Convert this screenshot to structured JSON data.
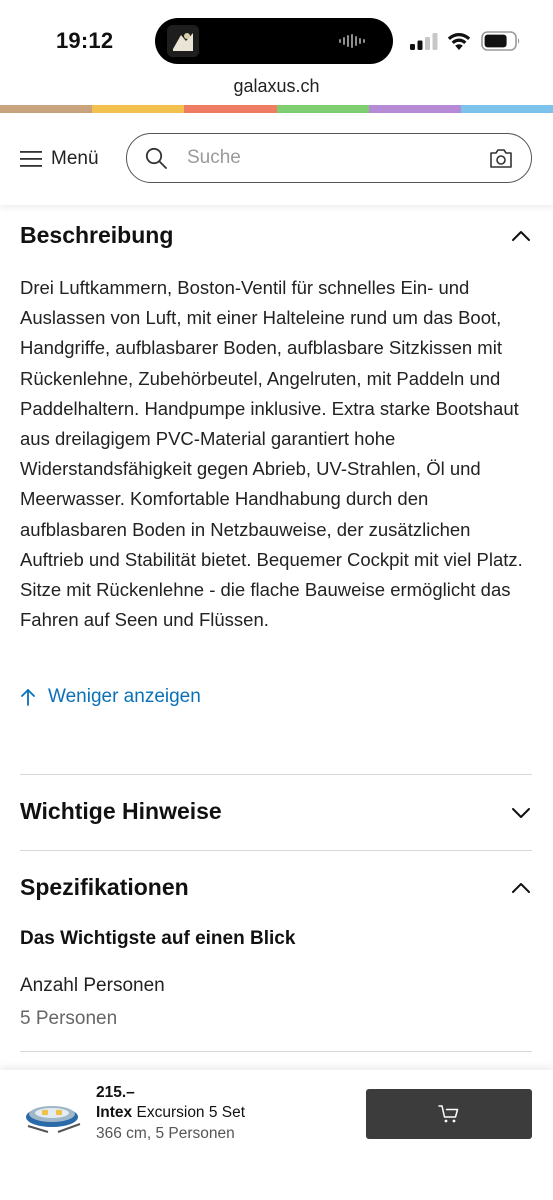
{
  "status_bar": {
    "time": "19:12"
  },
  "browser": {
    "url": "galaxus.ch"
  },
  "brand_stripe_colors": [
    "#c9a27e",
    "#f2c14e",
    "#ef7d63",
    "#7fce72",
    "#b78ad6",
    "#7cc4ec"
  ],
  "header": {
    "menu_label": "Menü",
    "search_placeholder": "Suche",
    "icons": [
      "hamburger-icon",
      "search-icon",
      "camera-icon"
    ]
  },
  "description": {
    "heading": "Beschreibung",
    "text": "Drei Luftkammern, Boston-Ventil für schnelles Ein- und Auslassen von Luft, mit einer Halteleine rund um das Boot, Handgriffe, aufblasbarer Boden, aufblasbare Sitzkissen mit Rückenlehne, Zubehörbeutel, Angelruten, mit Paddeln und Paddelhaltern. Handpumpe inklusive. Extra starke Bootshaut aus dreilagigem PVC-Material garantiert hohe Widerstandsfähigkeit gegen Abrieb, UV-Strahlen, Öl und Meerwasser. Komfortable Handhabung durch den aufblasbaren Boden in Netzbauweise, der zusätzlichen Auftrieb und Stabilität bietet. Bequemer Cockpit mit viel Platz. Sitze mit Rückenlehne - die flache Bauweise ermöglicht das Fahren auf Seen und Flüssen.",
    "show_less_label": "Weniger anzeigen",
    "expanded": true
  },
  "notes": {
    "heading": "Wichtige Hinweise",
    "expanded": false
  },
  "specifications": {
    "heading": "Spezifikationen",
    "expanded": true,
    "subheading": "Das Wichtigste auf einen Blick",
    "items": [
      {
        "label": "Anzahl Personen",
        "value": "5 Personen"
      }
    ]
  },
  "product_bar": {
    "price": "215.–",
    "brand": "Intex",
    "name": "Excursion 5 Set",
    "variant": "366 cm, 5 Personen",
    "link_color": "#0a70b8",
    "button_color": "#3c3c3c"
  }
}
